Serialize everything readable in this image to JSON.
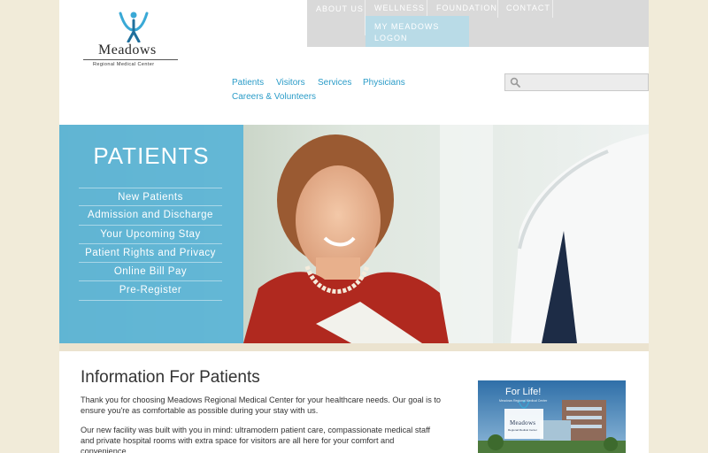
{
  "logo": {
    "name": "Meadows",
    "subtitle": "Regional Medical Center"
  },
  "top_nav": {
    "about": "ABOUT US",
    "wellness": "WELLNESS",
    "foundation": "FOUNDATION",
    "contact": "CONTACT",
    "my_meadows": "MY MEADOWS LOGON"
  },
  "main_nav": {
    "patients": "Patients",
    "visitors": "Visitors",
    "services": "Services",
    "physicians": "Physicians",
    "careers": "Careers & Volunteers"
  },
  "search": {
    "placeholder": ""
  },
  "hero": {
    "title": "PATIENTS",
    "menu": [
      "New Patients",
      "Admission and Discharge",
      "Your Upcoming Stay",
      "Patient Rights and Privacy",
      "Online Bill Pay",
      "Pre-Register"
    ]
  },
  "content": {
    "title": "Information For Patients",
    "paragraph_1": "Thank you for choosing Meadows Regional Medical Center for your healthcare needs. Our goal is to ensure you're as comfortable as possible during your stay with us.",
    "paragraph_2": "Our new facility was built with you in mind: ultramodern patient care, compassionate medical staff and private hospital rooms with extra space for visitors are all here for your comfort and convenience."
  },
  "promo": {
    "title": "For Life!",
    "subtitle": "Meadows Regional Medical Center",
    "brand": "Meadows",
    "brand_sub": "Regional Medical Center"
  },
  "colors": {
    "accent": "#2b9cc8",
    "panel": "#5ab4d7",
    "background": "#f1ebd9"
  }
}
